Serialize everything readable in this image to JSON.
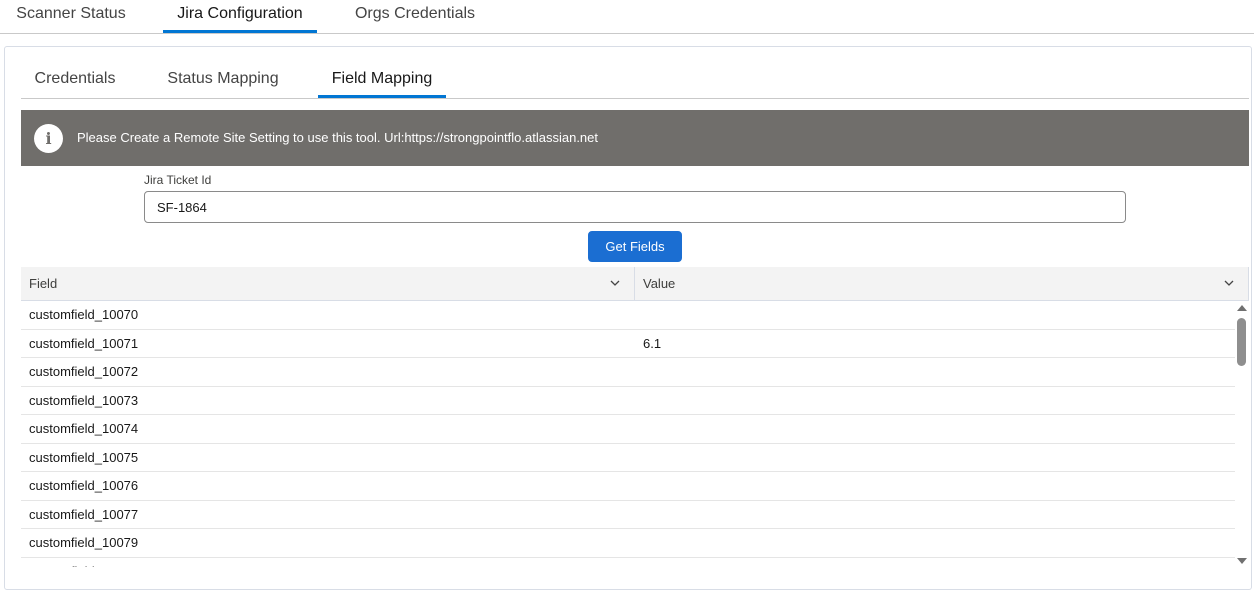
{
  "top_tabs": [
    {
      "label": "Scanner Status"
    },
    {
      "label": "Jira Configuration"
    },
    {
      "label": "Orgs Credentials"
    }
  ],
  "top_tabs_active": "Jira Configuration",
  "sub_tabs": [
    {
      "label": "Credentials"
    },
    {
      "label": "Status Mapping"
    },
    {
      "label": "Field Mapping"
    }
  ],
  "sub_tabs_active": "Field Mapping",
  "alert": {
    "icon": "info-icon",
    "message": "Please Create a Remote Site Setting to use this tool. Url:https://strongpointflo.atlassian.net"
  },
  "form": {
    "ticket_label": "Jira Ticket Id",
    "ticket_value": "SF-1864",
    "button_label": "Get Fields"
  },
  "table": {
    "columns": [
      "Field",
      "Value"
    ],
    "rows": [
      {
        "field": "customfield_10070",
        "value": ""
      },
      {
        "field": "customfield_10071",
        "value": "6.1"
      },
      {
        "field": "customfield_10072",
        "value": ""
      },
      {
        "field": "customfield_10073",
        "value": ""
      },
      {
        "field": "customfield_10074",
        "value": ""
      },
      {
        "field": "customfield_10075",
        "value": ""
      },
      {
        "field": "customfield_10076",
        "value": ""
      },
      {
        "field": "customfield_10077",
        "value": ""
      },
      {
        "field": "customfield_10079",
        "value": ""
      },
      {
        "field": "customfield_",
        "value": ""
      }
    ]
  },
  "colors": {
    "accent": "#0176d3",
    "button": "#1b6ed2",
    "alert_bg": "#706e6b"
  }
}
